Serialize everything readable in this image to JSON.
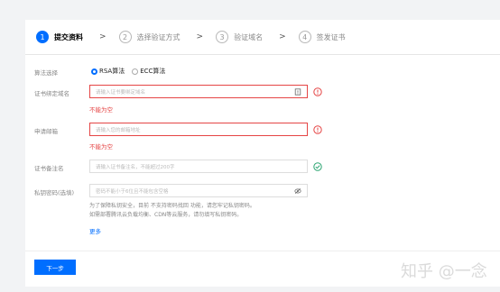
{
  "steps": [
    {
      "num": "1",
      "label": "提交资料"
    },
    {
      "num": "2",
      "label": "选择验证方式"
    },
    {
      "num": "3",
      "label": "验证域名"
    },
    {
      "num": "4",
      "label": "签发证书"
    }
  ],
  "step_arrow": ">",
  "form": {
    "algorithm": {
      "label": "算法选择",
      "options": [
        {
          "label": "RSA算法",
          "selected": true
        },
        {
          "label": "ECC算法",
          "selected": false
        }
      ]
    },
    "domain": {
      "label": "证书绑定域名",
      "placeholder": "请输入证书要绑定域名",
      "error": "不能为空"
    },
    "email": {
      "label": "申请邮箱",
      "placeholder": "请输入您的邮箱地址",
      "error": "不能为空"
    },
    "remark": {
      "label": "证书备注名",
      "placeholder": "请输入证书备注名，不能超过200字"
    },
    "password": {
      "label": "私钥密码(选填)",
      "placeholder": "密码不能小于6位且不能包含空格",
      "help_line1": "为了保障私钥安全，目前 不支持密码找回 功能，请您牢记私钥密码。",
      "help_line2": "如需部署腾讯云负载均衡、CDN等云服务，请勿填写私钥密码。",
      "more": "更多"
    }
  },
  "next_button": "下一步",
  "watermark": "知乎 @一念",
  "colors": {
    "primary": "#006eff",
    "error": "#e54545",
    "success": "#2ba471"
  }
}
